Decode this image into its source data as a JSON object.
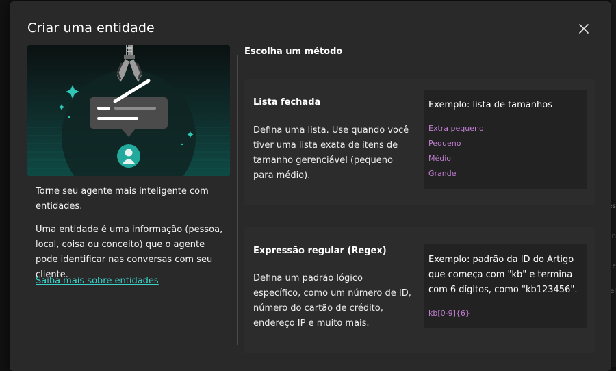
{
  "dialog": {
    "title": "Criar uma entidade",
    "close_icon": "close-icon"
  },
  "left_panel": {
    "illustration_icon": "claw-picking-message-illustration",
    "headline": "Torne seu agente mais inteligente com entidades.",
    "body": "Uma entidade é uma informação (pessoa, local, coisa ou conceito) que o agente pode identificar nas conversas com seu cliente.",
    "link": "Saiba mais sobre entidades"
  },
  "methods": {
    "heading": "Escolha um método",
    "closed_list": {
      "title": "Lista fechada",
      "description": "Defina uma lista. Use quando você tiver uma lista exata de itens de tamanho gerenciável (pequeno para médio).",
      "example_title": "Exemplo: lista de tamanhos",
      "example_items": [
        "Extra pequeno",
        "Pequeno",
        "Médio",
        "Grande"
      ]
    },
    "regex": {
      "title": "Expressão regular (Regex)",
      "description": "Defina um padrão lógico específico, como um número de ID, número do cartão de crédito, endereço IP e muito mais.",
      "example_title": "Exemplo: padrão da ID do Artigo que começa com \"kb\" e termina com 6 dígitos, como \"kb123456\".",
      "example_items": [
        "kb[0-9]{6}"
      ]
    }
  },
  "colors": {
    "accent_link": "#3ccfc8",
    "example_item": "#c17ed3",
    "dialog_bg": "#292929"
  }
}
